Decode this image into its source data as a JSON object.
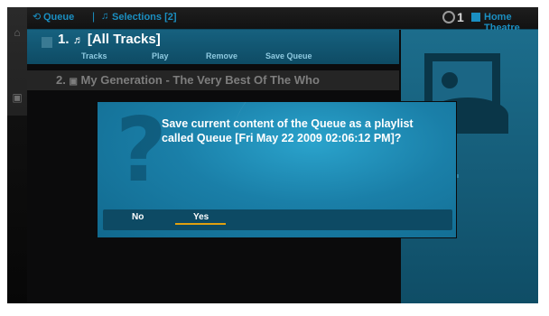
{
  "tabs": [
    {
      "label": "Queue"
    },
    {
      "label": "Selections [2]"
    }
  ],
  "zone": {
    "count": "1",
    "name": "Home Theatre"
  },
  "queue": {
    "items": [
      {
        "number": "1.",
        "title": "[All Tracks]"
      },
      {
        "number": "2.",
        "title": "My Generation - The Very Best Of The Who"
      }
    ],
    "actions": [
      "Tracks",
      "Play",
      "Remove",
      "Save Queue"
    ]
  },
  "dialog": {
    "message": "Save current content of the Queue as a playlist called Queue [Fri May 22 2009 02:06:12 PM]?",
    "buttons": [
      "No",
      "Yes"
    ],
    "selected": "Yes"
  },
  "colors": {
    "accent": "#1a8fc2",
    "selection": "#e0a010",
    "dialog": "#1a7fa8"
  }
}
